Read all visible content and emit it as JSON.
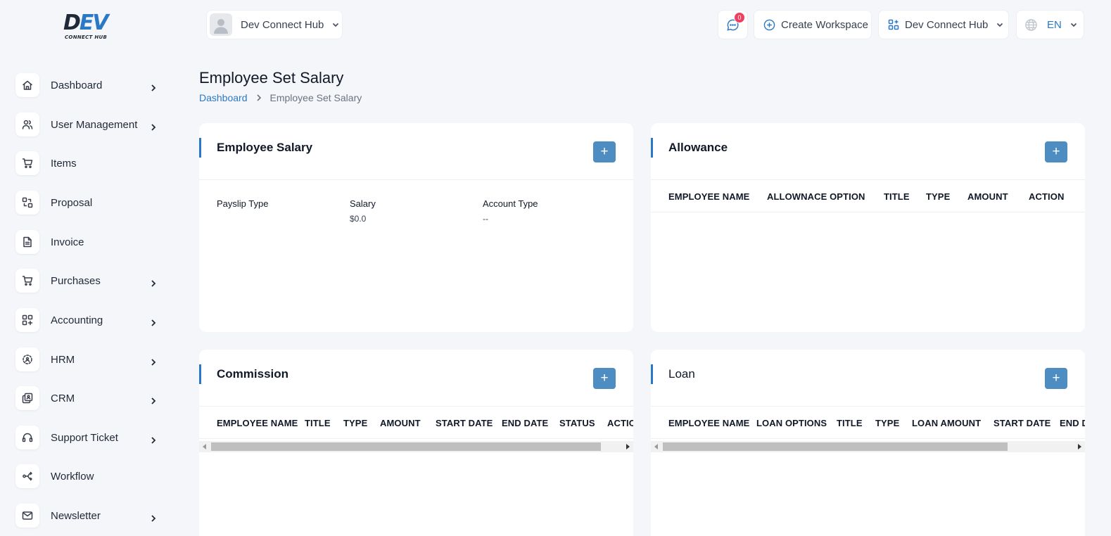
{
  "logo": {
    "text_a": "D",
    "text_b": "EV",
    "sub": "CONNECT HUB"
  },
  "sidebar": {
    "items": [
      {
        "label": "Dashboard",
        "icon": "home-icon",
        "has_children": true
      },
      {
        "label": "User Management",
        "icon": "users-icon",
        "has_children": true
      },
      {
        "label": "Items",
        "icon": "cart-icon",
        "has_children": false
      },
      {
        "label": "Proposal",
        "icon": "proposal-icon",
        "has_children": false
      },
      {
        "label": "Invoice",
        "icon": "file-icon",
        "has_children": false
      },
      {
        "label": "Purchases",
        "icon": "cart-icon",
        "has_children": true
      },
      {
        "label": "Accounting",
        "icon": "grid-plus-icon",
        "has_children": true
      },
      {
        "label": "HRM",
        "icon": "hrm-icon",
        "has_children": true
      },
      {
        "label": "CRM",
        "icon": "crm-icon",
        "has_children": true
      },
      {
        "label": "Support Ticket",
        "icon": "headset-icon",
        "has_children": true
      },
      {
        "label": "Workflow",
        "icon": "workflow-icon",
        "has_children": false
      },
      {
        "label": "Newsletter",
        "icon": "mail-icon",
        "has_children": true
      }
    ]
  },
  "header": {
    "workspace": "Dev Connect Hub",
    "message_count": "0",
    "create_workspace": "Create Workspace",
    "company": "Dev Connect Hub",
    "language": "EN"
  },
  "page": {
    "title": "Employee Set Salary",
    "breadcrumb_home": "Dashboard",
    "breadcrumb_current": "Employee Set Salary"
  },
  "cards": {
    "salary": {
      "title": "Employee Salary",
      "add": "+",
      "payslip_label": "Payslip Type",
      "salary_label": "Salary",
      "salary_value": "$0.0",
      "account_label": "Account Type",
      "account_value": "--"
    },
    "allowance": {
      "title": "Allowance",
      "add": "+",
      "columns": [
        "EMPLOYEE NAME",
        "ALLOWNACE OPTION",
        "TITLE",
        "TYPE",
        "AMOUNT",
        "ACTION"
      ]
    },
    "commission": {
      "title": "Commission",
      "add": "+",
      "columns": [
        "EMPLOYEE NAME",
        "TITLE",
        "TYPE",
        "AMOUNT",
        "START DATE",
        "END DATE",
        "STATUS",
        "ACTIO"
      ]
    },
    "loan": {
      "title": "Loan",
      "add": "+",
      "columns": [
        "EMPLOYEE NAME",
        "LOAN OPTIONS",
        "TITLE",
        "TYPE",
        "LOAN AMOUNT",
        "START DATE",
        "END D"
      ]
    }
  },
  "colors": {
    "accent": "#2b78c5",
    "button": "#4e8dc1",
    "badge": "#ef3f5f",
    "background": "#f5f6fa"
  }
}
